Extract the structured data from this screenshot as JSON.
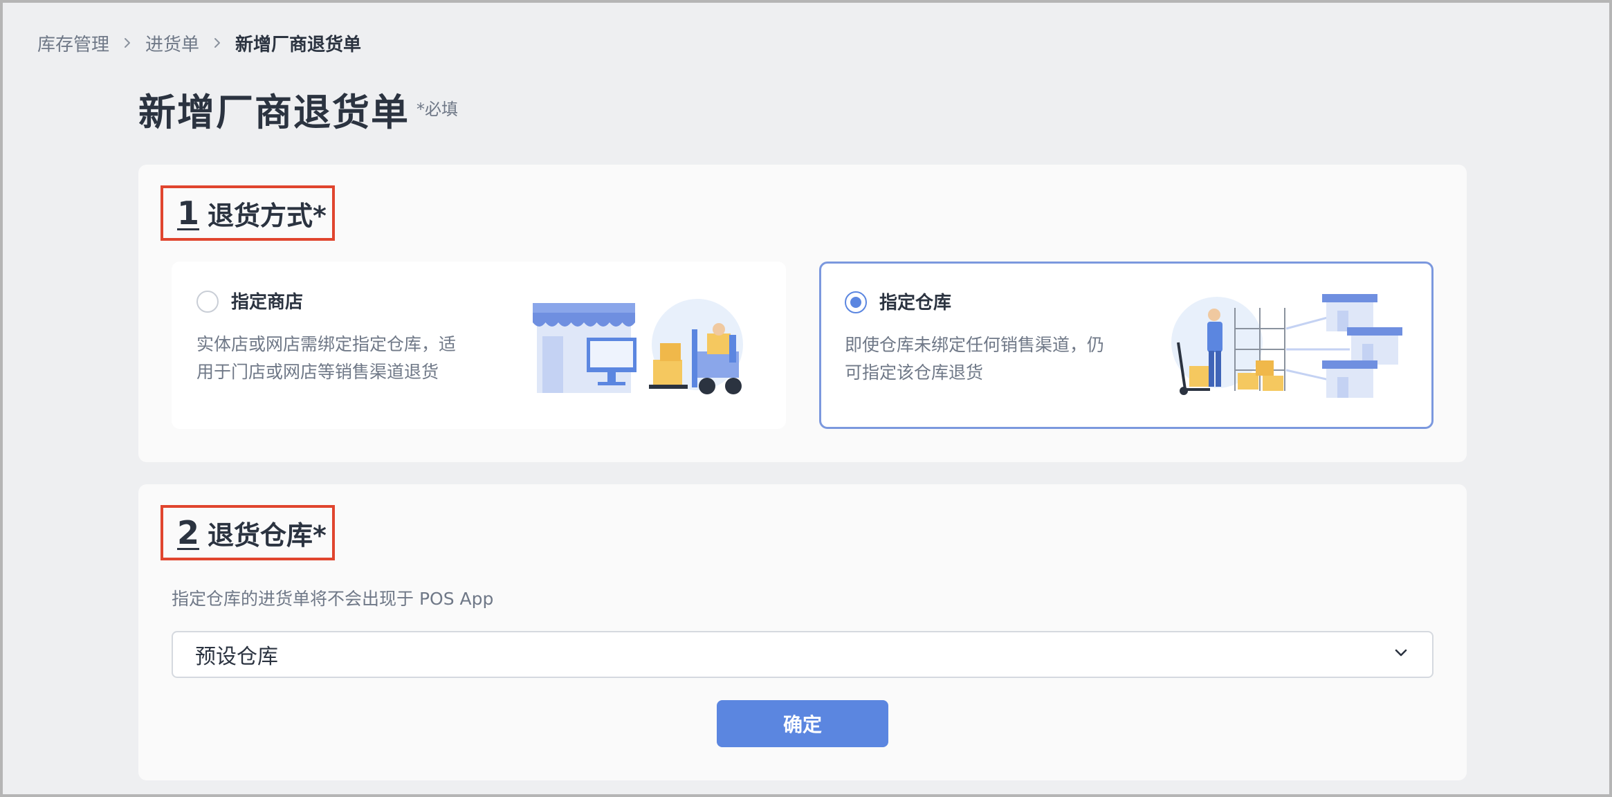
{
  "breadcrumb": {
    "items": [
      "库存管理",
      "进货单",
      "新增厂商退货单"
    ]
  },
  "page": {
    "title": "新增厂商退货单",
    "required_note": "*必填"
  },
  "section1": {
    "step": "1",
    "heading": "退货方式*",
    "options": [
      {
        "title": "指定商店",
        "desc_line1": "实体店或网店需绑定指定仓库，适",
        "desc_line2": "用于门店或网店等销售渠道退货",
        "selected": false,
        "icon": "storefront-forklift-illustration"
      },
      {
        "title": "指定仓库",
        "desc_line1": "即使仓库未绑定任何销售渠道，仍",
        "desc_line2": "可指定该仓库退货",
        "selected": true,
        "icon": "warehouse-distribution-illustration"
      }
    ]
  },
  "section2": {
    "step": "2",
    "heading": "退货仓库*",
    "hint": "指定仓库的进货单将不会出现于 POS App",
    "select": {
      "value": "预设仓库"
    },
    "confirm_label": "确定"
  },
  "colors": {
    "accent": "#5b86e0",
    "highlight_border": "#e0452e",
    "selected_card_border": "#7b98de",
    "page_bg": "#eeeff1"
  }
}
